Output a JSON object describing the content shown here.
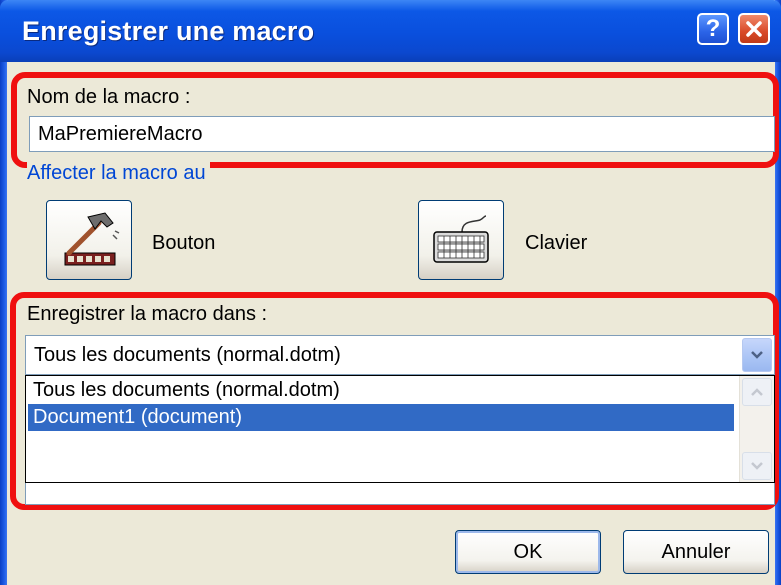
{
  "dialog": {
    "title": "Enregistrer une macro",
    "help_label": "?",
    "close_label": "X"
  },
  "macro_name": {
    "label": "Nom de la macro :",
    "value": "MaPremiereMacro"
  },
  "assign": {
    "legend": "Affecter la macro au",
    "button_label": "Bouton",
    "keyboard_label": "Clavier",
    "button_icon": "hammer-icon",
    "keyboard_icon": "keyboard-icon"
  },
  "store_in": {
    "label": "Enregistrer la macro dans :",
    "selected": "Tous les documents (normal.dotm)",
    "options": [
      "Tous les documents (normal.dotm)",
      "Document1 (document)"
    ],
    "highlighted_index": 1
  },
  "buttons": {
    "ok": "OK",
    "cancel": "Annuler"
  },
  "colors": {
    "title_bar": "#0a4fdd",
    "highlight_box": "#ef1010",
    "selection": "#316ac5",
    "dialog_bg": "#ece9d8",
    "legend_text": "#0046d5"
  }
}
